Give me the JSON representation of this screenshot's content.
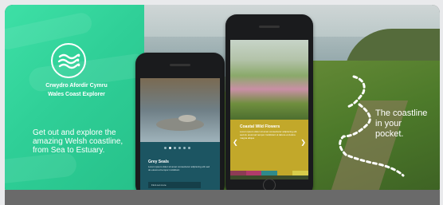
{
  "brand": {
    "title_line1": "Crwydro Afordir Cymru",
    "title_line2": "Wales Coast Explorer",
    "logo_icon": "waves-icon"
  },
  "tagline": "Get out and explore the amazing Welsh coastline, from Sea to Estuary.",
  "coast_text": "The coastline in your pocket.",
  "phone_left": {
    "card_title": "Grey Seals",
    "card_body": "Lorem ipsum dolor sit amet consectetur adipiscing elit sed do eiusmod tempor incididunt",
    "button_label": "Find out more",
    "carousel_index": 1,
    "carousel_count": 6
  },
  "phone_right": {
    "card_title": "Coastal Wild Flowers",
    "card_body": "Lorem ipsum dolor sit amet consectetur adipiscing elit sed do eiusmod tempor incididunt ut labore et dolore magna aliqua",
    "prev_icon": "chevron-left-icon",
    "next_icon": "chevron-right-icon",
    "color_bar": [
      "#8d3b55",
      "#b13b6a",
      "#2f8a8b",
      "#c2a82a",
      "#d8cc4a"
    ]
  },
  "colors": {
    "brand_green": "#2fcf97",
    "seal_card": "#1c5562",
    "flower_card": "#c2a82a"
  }
}
